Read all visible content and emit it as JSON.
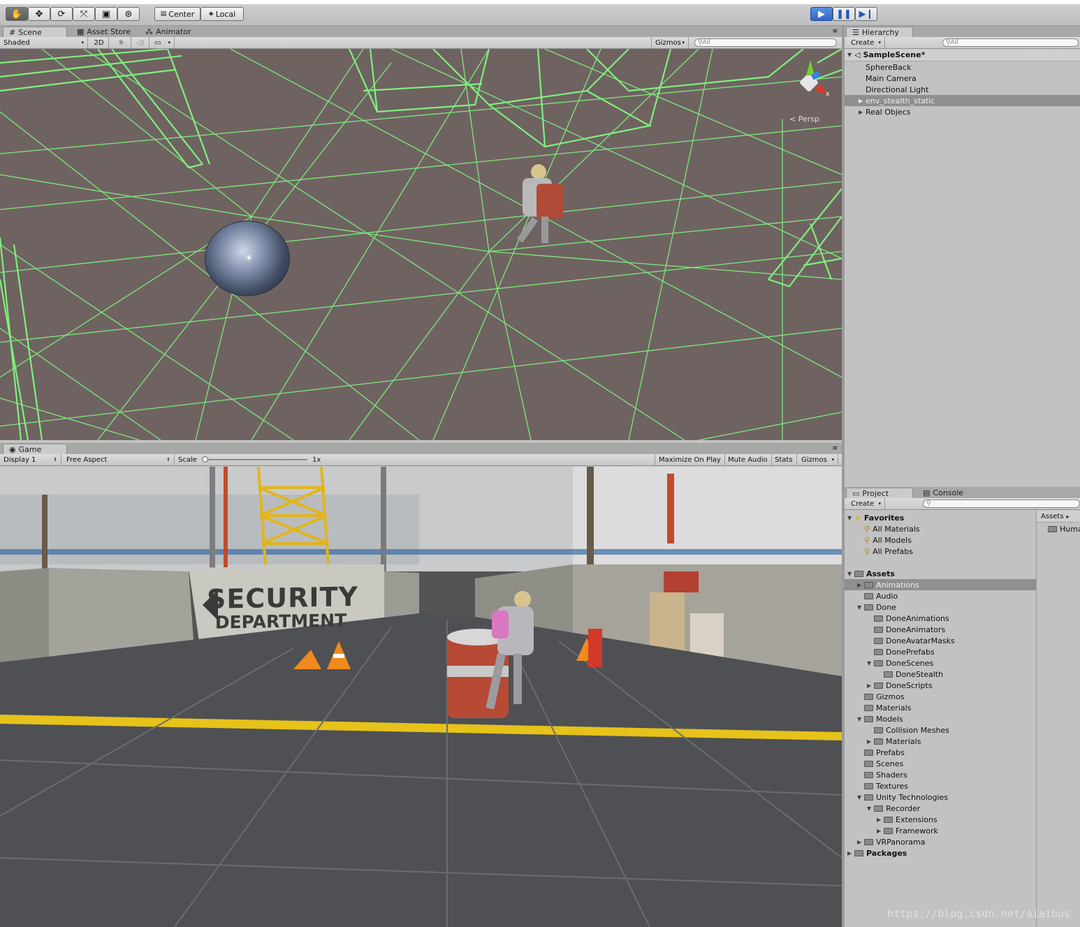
{
  "toolbar": {
    "tool_icons": [
      "hand-icon",
      "move-icon",
      "rotate-icon",
      "scale-icon",
      "rect-icon",
      "transform-icon"
    ],
    "pivot_label": "Center",
    "space_label": "Local",
    "play_icons": [
      "play-icon",
      "pause-icon",
      "step-icon"
    ]
  },
  "scene_panel": {
    "tabs": [
      {
        "label": "Scene",
        "icon": "grid-icon"
      },
      {
        "label": "Asset Store",
        "icon": "bag-icon"
      },
      {
        "label": "Animator",
        "icon": "animator-icon"
      }
    ],
    "shading_mode": "Shaded",
    "mode_2d": "2D",
    "gizmos_label": "Gizmos",
    "search_placeholder": "All",
    "gizmo_label": "Persp",
    "axis_x": "x"
  },
  "game_panel": {
    "tab": "Game",
    "display": "Display 1",
    "aspect": "Free Aspect",
    "scale_label": "Scale",
    "scale_value": "1x",
    "buttons": [
      "Maximize On Play",
      "Mute Audio",
      "Stats",
      "Gizmos"
    ],
    "sign_line1": "SECURITY",
    "sign_line2": "DEPARTMENT"
  },
  "hierarchy": {
    "tab": "Hierarchy",
    "create_label": "Create",
    "search_placeholder": "All",
    "scene_name": "SampleScene*",
    "items": [
      {
        "label": "SphereBack",
        "selected": false,
        "expandable": false
      },
      {
        "label": "Main Camera",
        "selected": false,
        "expandable": false
      },
      {
        "label": "Directional Light",
        "selected": false,
        "expandable": false
      },
      {
        "label": "env_stealth_static",
        "selected": true,
        "expandable": true
      },
      {
        "label": "Real Objecs",
        "selected": false,
        "expandable": true
      }
    ]
  },
  "project": {
    "tabs": [
      "Project",
      "Console"
    ],
    "create_label": "Create",
    "breadcrumb": "Assets",
    "right_item": "Huma",
    "tree": [
      {
        "label": "Favorites",
        "level": 0,
        "bold": true,
        "arrow": "down",
        "kind": "star"
      },
      {
        "label": "All Materials",
        "level": 1,
        "kind": "search"
      },
      {
        "label": "All Models",
        "level": 1,
        "kind": "search"
      },
      {
        "label": "All Prefabs",
        "level": 1,
        "kind": "search"
      },
      {
        "label": "",
        "level": 0,
        "kind": "gap"
      },
      {
        "label": "Assets",
        "level": 0,
        "bold": true,
        "arrow": "down",
        "kind": "folder"
      },
      {
        "label": "Animations",
        "level": 1,
        "arrow": "right",
        "kind": "folder",
        "selected": true
      },
      {
        "label": "Audio",
        "level": 1,
        "kind": "folder"
      },
      {
        "label": "Done",
        "level": 1,
        "arrow": "down",
        "kind": "folder"
      },
      {
        "label": "DoneAnimations",
        "level": 2,
        "kind": "folder"
      },
      {
        "label": "DoneAnimators",
        "level": 2,
        "kind": "folder"
      },
      {
        "label": "DoneAvatarMasks",
        "level": 2,
        "kind": "folder"
      },
      {
        "label": "DonePrefabs",
        "level": 2,
        "kind": "folder"
      },
      {
        "label": "DoneScenes",
        "level": 2,
        "arrow": "down",
        "kind": "folder"
      },
      {
        "label": "DoneStealth",
        "level": 3,
        "kind": "folder"
      },
      {
        "label": "DoneScripts",
        "level": 2,
        "arrow": "right",
        "kind": "folder"
      },
      {
        "label": "Gizmos",
        "level": 1,
        "kind": "folder"
      },
      {
        "label": "Materials",
        "level": 1,
        "kind": "folder"
      },
      {
        "label": "Models",
        "level": 1,
        "arrow": "down",
        "kind": "folder"
      },
      {
        "label": "Collision Meshes",
        "level": 2,
        "kind": "folder"
      },
      {
        "label": "Materials",
        "level": 2,
        "arrow": "right",
        "kind": "folder"
      },
      {
        "label": "Prefabs",
        "level": 1,
        "kind": "folder"
      },
      {
        "label": "Scenes",
        "level": 1,
        "kind": "folder"
      },
      {
        "label": "Shaders",
        "level": 1,
        "kind": "folder"
      },
      {
        "label": "Textures",
        "level": 1,
        "kind": "folder"
      },
      {
        "label": "Unity Technologies",
        "level": 1,
        "arrow": "down",
        "kind": "folder"
      },
      {
        "label": "Recorder",
        "level": 2,
        "arrow": "down",
        "kind": "folder"
      },
      {
        "label": "Extensions",
        "level": 3,
        "arrow": "right",
        "kind": "folder"
      },
      {
        "label": "Framework",
        "level": 3,
        "arrow": "right",
        "kind": "folder"
      },
      {
        "label": "VRPanorama",
        "level": 1,
        "arrow": "right",
        "kind": "folder"
      },
      {
        "label": "Packages",
        "level": 0,
        "bold": true,
        "arrow": "right",
        "kind": "folder"
      }
    ]
  },
  "watermark": "https://blog.csdn.net/aiaibus",
  "colors": {
    "wire": "#7ff07f",
    "scene_floor": "#6f6361",
    "selected_row": "#8f8f8f",
    "play_blue": "#2f64c8"
  }
}
